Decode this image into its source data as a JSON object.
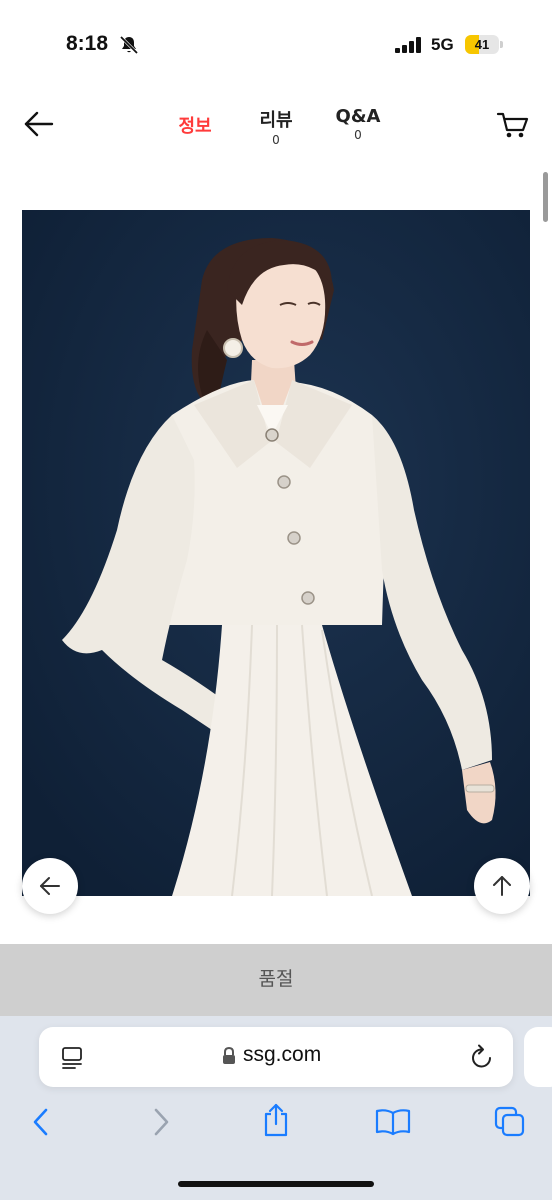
{
  "status_bar": {
    "time": "8:18",
    "network": "5G",
    "battery_level": 41,
    "battery_label": "41",
    "icons": [
      "bell-slash-icon",
      "signal-icon",
      "battery-icon"
    ]
  },
  "header": {
    "back_icon": "arrow-left-icon",
    "tabs": [
      {
        "label": "정보",
        "count": "",
        "active": true
      },
      {
        "label": "리뷰",
        "count": "0",
        "active": false
      },
      {
        "label": "Q&A",
        "count": "0",
        "active": false
      }
    ],
    "cart_icon": "cart-icon"
  },
  "colors": {
    "active_tab": "#ff3b3b",
    "image_background": "#13263f",
    "soldout_bar": "#cfcfcf",
    "battery_fill": "#f7c600",
    "safari_accent": "#1a7cff"
  },
  "product": {
    "image_icon": "product-photo-white-tweed-jacket-dress"
  },
  "floating_buttons": {
    "back_icon": "arrow-left-icon",
    "top_icon": "arrow-up-icon"
  },
  "soldout": {
    "label": "품절"
  },
  "browser": {
    "url": "ssg.com",
    "icons": [
      "reader-icon",
      "lock-icon",
      "reload-icon",
      "back-chevron-icon",
      "forward-chevron-icon",
      "share-icon",
      "bookmarks-icon",
      "tabs-icon"
    ]
  }
}
